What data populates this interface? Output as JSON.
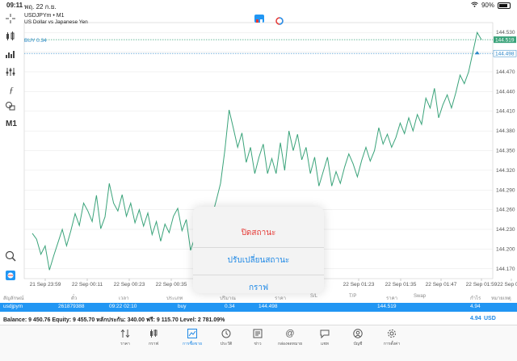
{
  "status": {
    "time": "09:11",
    "date": "พฤ. 22 ก.ย.",
    "battery": "90%"
  },
  "toolbar": {
    "timeframe": "M1"
  },
  "chart": {
    "symbol": "USDJPYm • M1",
    "description": "US Dollar vs Japanese Yen",
    "buy_label": "BUY 0.34",
    "price_badge_current": "144.519",
    "price_badge_buy": "144.498",
    "y_ticks": [
      "144.530",
      "144.500",
      "144.470",
      "144.440",
      "144.410",
      "144.380",
      "144.350",
      "144.320",
      "144.290",
      "144.260",
      "144.230",
      "144.200",
      "144.170"
    ],
    "x_ticks": [
      "21 Sep 23:59",
      "22 Sep 00:11",
      "22 Sep 00:23",
      "22 Sep 00:35",
      "22 Sep 01:23",
      "22 Sep 01:35",
      "22 Sep 01:47",
      "22 Sep 01:59",
      "22 Sep 02:1"
    ]
  },
  "chart_data": {
    "type": "line",
    "series": [
      {
        "values": [
          144.224,
          144.215,
          144.192,
          144.205,
          144.168,
          144.19,
          144.21,
          144.23,
          144.205,
          144.228,
          144.254,
          144.236,
          144.27,
          144.258,
          144.242,
          144.282,
          144.231,
          144.249,
          144.3,
          144.27,
          144.258,
          144.283,
          144.25,
          144.27,
          144.24,
          144.26,
          144.235,
          144.255,
          144.222,
          144.242,
          144.212,
          144.238,
          144.225,
          144.25,
          144.262,
          144.228,
          144.245,
          144.198,
          144.218,
          144.18,
          144.2,
          144.23,
          144.25,
          144.274,
          144.3,
          144.35,
          144.412,
          144.384,
          144.355,
          144.377,
          144.332,
          144.355,
          144.315,
          144.34,
          144.36,
          144.315,
          144.338,
          144.315,
          144.362,
          144.32,
          144.38,
          144.35,
          144.375,
          144.336,
          144.355,
          144.315,
          144.34,
          144.296,
          144.318,
          144.34,
          144.296,
          144.318,
          144.3,
          144.325,
          144.345,
          144.33,
          144.31,
          144.335,
          144.355,
          144.334,
          144.35,
          144.385,
          144.36,
          144.375,
          144.355,
          144.37,
          144.392,
          144.376,
          144.4,
          144.38,
          144.405,
          144.39,
          144.43,
          144.415,
          144.445,
          144.4,
          144.42,
          144.435,
          144.415,
          144.438,
          144.465,
          144.452,
          144.47,
          144.5,
          144.53,
          144.519
        ]
      }
    ],
    "ylim": [
      144.155,
      144.545
    ],
    "current_price": 144.519,
    "buy_price": 144.498,
    "colors": {
      "line": "#3aa37a",
      "grid": "#e4e4e4",
      "current": "#3aa37a",
      "buy": "#2a86c8"
    }
  },
  "menu": {
    "items": [
      "ปิดสถานะ",
      "ปรับเปลี่ยนสถานะ",
      "กราฟ"
    ]
  },
  "table": {
    "headers": [
      "สัญลักษณ์",
      "ตั๋ว",
      "เวลา",
      "ประเภท",
      "ปริมาณ",
      "ราคา",
      "S/L",
      "T/P",
      "ราคา",
      "Swap",
      "กำไร",
      "หมายเหตุ"
    ],
    "row": {
      "symbol": "usdjpym",
      "ticket": "261879388",
      "time": "09:22 02:10",
      "type": "buy",
      "volume": "0.34",
      "price": "144.498",
      "current": "144.519",
      "profit": "4.94"
    }
  },
  "balance": {
    "text": "Balance: 9 450.76 Equity: 9 455.70 หลักประกัน: 340.00 ฟรี: 9 115.70 Level: 2 781.09%",
    "value": "4.94",
    "currency": "USD"
  },
  "tabs": [
    {
      "label": "ราคา",
      "icon": "arrows-icon"
    },
    {
      "label": "กราฟ",
      "icon": "candles-icon"
    },
    {
      "label": "การซื้อขาย",
      "icon": "trade-icon"
    },
    {
      "label": "ประวัติ",
      "icon": "history-icon"
    },
    {
      "label": "ข่าว",
      "icon": "news-icon"
    },
    {
      "label": "กล่องจดหมาย",
      "icon": "at-icon"
    },
    {
      "label": "แชท",
      "icon": "chat-icon"
    },
    {
      "label": "บัญชี",
      "icon": "account-icon"
    },
    {
      "label": "การตั้งค่า",
      "icon": "settings-icon"
    }
  ]
}
